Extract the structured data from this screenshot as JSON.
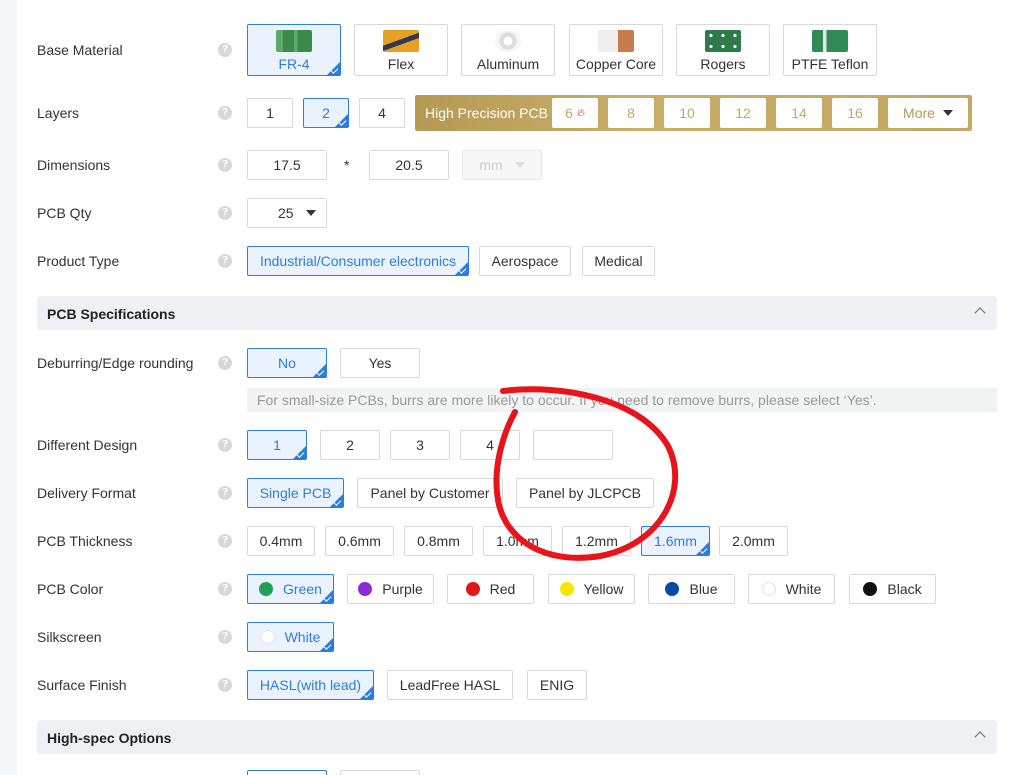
{
  "base_material": {
    "label": "Base Material",
    "options": [
      {
        "label": "FR-4",
        "selected": true,
        "color": "#3c8a4a"
      },
      {
        "label": "Flex",
        "selected": false,
        "color": "#e8a024"
      },
      {
        "label": "Aluminum",
        "selected": false,
        "color": "#cccccc"
      },
      {
        "label": "Copper Core",
        "selected": false,
        "color": "#c97b4e"
      },
      {
        "label": "Rogers",
        "selected": false,
        "color": "#2f7a4a"
      },
      {
        "label": "PTFE Teflon",
        "selected": false,
        "color": "#2f8a58"
      }
    ]
  },
  "layers": {
    "label": "Layers",
    "options": [
      "1",
      "2",
      "4"
    ],
    "selected": "2",
    "high_precision_label": "High Precision PCB",
    "high_precision_options": [
      "6",
      "8",
      "10",
      "12",
      "14",
      "16"
    ],
    "more_label": "More"
  },
  "dimensions": {
    "label": "Dimensions",
    "width": "17.5",
    "separator": "*",
    "height": "20.5",
    "unit": "mm"
  },
  "pcb_qty": {
    "label": "PCB Qty",
    "value": "25"
  },
  "product_type": {
    "label": "Product Type",
    "options": [
      "Industrial/Consumer electronics",
      "Aerospace",
      "Medical"
    ],
    "selected": "Industrial/Consumer electronics"
  },
  "pcb_specifications": {
    "title": "PCB Specifications"
  },
  "deburring": {
    "label": "Deburring/Edge rounding",
    "options": [
      "No",
      "Yes"
    ],
    "selected": "No",
    "note": "For small-size PCBs, burrs are more likely to occur. If you need to remove burrs, please select ‘Yes’."
  },
  "different_design": {
    "label": "Different Design",
    "options": [
      "1",
      "2",
      "3",
      "4"
    ],
    "selected": "1",
    "custom_value": ""
  },
  "delivery_format": {
    "label": "Delivery Format",
    "options": [
      "Single PCB",
      "Panel by Customer",
      "Panel by JLCPCB"
    ],
    "selected": "Single PCB"
  },
  "pcb_thickness": {
    "label": "PCB Thickness",
    "options": [
      "0.4mm",
      "0.6mm",
      "0.8mm",
      "1.0mm",
      "1.2mm",
      "1.6mm",
      "2.0mm"
    ],
    "selected": "1.6mm"
  },
  "pcb_color": {
    "label": "PCB Color",
    "options": [
      {
        "label": "Green",
        "color": "#22a05a"
      },
      {
        "label": "Purple",
        "color": "#8b2bd6"
      },
      {
        "label": "Red",
        "color": "#e01818"
      },
      {
        "label": "Yellow",
        "color": "#f7e600"
      },
      {
        "label": "Blue",
        "color": "#0d4aa8"
      },
      {
        "label": "White",
        "color": "#ffffff"
      },
      {
        "label": "Black",
        "color": "#111111"
      }
    ],
    "selected": "Green"
  },
  "silkscreen": {
    "label": "Silkscreen",
    "value": "White"
  },
  "surface_finish": {
    "label": "Surface Finish",
    "options": [
      "HASL(with lead)",
      "LeadFree HASL",
      "ENIG"
    ],
    "selected": "HASL(with lead)"
  },
  "high_spec_options": {
    "title": "High-spec Options"
  },
  "colors": {
    "accent": "#2b7de0",
    "annotation": "#e8141c",
    "gold": "#c4a864"
  }
}
